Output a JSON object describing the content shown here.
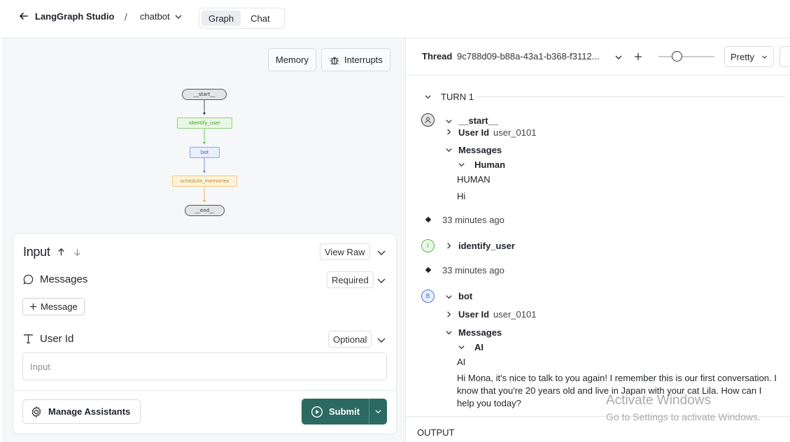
{
  "app": {
    "title": "LangGraph Studio",
    "separator": "/",
    "project": "chatbot"
  },
  "view_tabs": [
    {
      "label": "Graph",
      "active": true
    },
    {
      "label": "Chat",
      "active": false
    }
  ],
  "left": {
    "memory_button": "Memory",
    "interrupts_button": "Interrupts",
    "graph_nodes": {
      "start": "__start__",
      "identify_user": "identify_user",
      "bot": "bot",
      "schedule_memories": "schedule_memories",
      "end": "__end__"
    },
    "input_panel": {
      "title": "Input",
      "view_raw": "View Raw",
      "messages_label": "Messages",
      "messages_badge": "Required",
      "add_message": "Message",
      "user_id_label": "User Id",
      "user_id_badge": "Optional",
      "user_id_placeholder": "Input",
      "manage_assistants": "Manage Assistants",
      "submit": "Submit"
    }
  },
  "right": {
    "thread_label": "Thread",
    "thread_id": "9c788d09-b88a-43a1-b368-f3112...",
    "view_mode": "Pretty",
    "turn_label": "TURN 1",
    "start_node": "__start__",
    "start_avatar": "person-icon",
    "user_id_key": "User Id",
    "user_id_value": "user_0101",
    "messages_key": "Messages",
    "human_header": "Human",
    "human_type": "HUMAN",
    "human_message": "Hi",
    "time1": "33 minutes ago",
    "identify_avatar": "I",
    "identify_node": "identify_user",
    "time2": "33 minutes ago",
    "bot_avatar": "B",
    "bot_node": "bot",
    "bot_user_id_key": "User Id",
    "bot_user_id_value": "user_0101",
    "bot_messages_key": "Messages",
    "ai_header": "AI",
    "ai_type": "AI",
    "ai_message": "Hi Mona, it's nice to talk to you again! I remember this is our first conversation. I know that you're 20 years old and live in Japan with your cat Lila. How can I help you today?",
    "output_label": "OUTPUT"
  },
  "watermark": {
    "line1": "Activate Windows",
    "line2": "Go to Settings to activate Windows."
  }
}
